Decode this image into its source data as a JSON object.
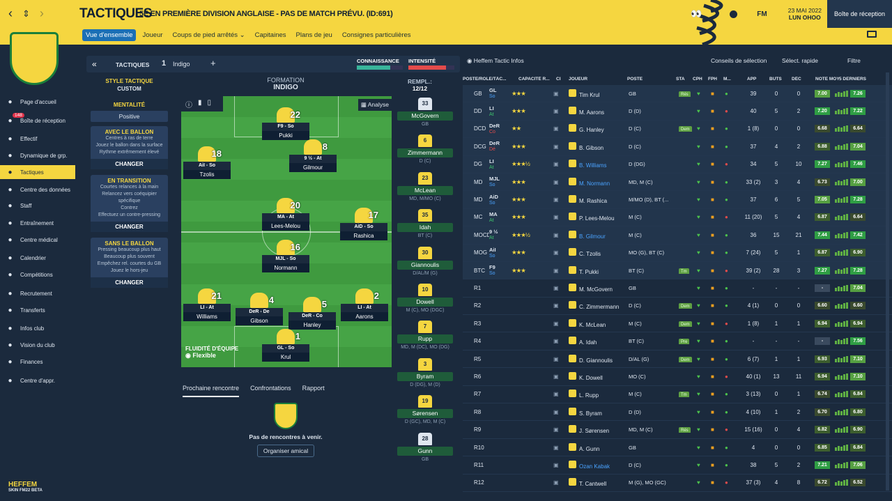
{
  "header": {
    "title": "TACTIQUES",
    "subtitle": "5E EN PREMIÈRE DIVISION ANGLAISE - PAS DE MATCH PRÉVU. (ID:691)",
    "date": "23 MAI 2022",
    "day": "LUN OHOO",
    "inbox": "Boîte de réception",
    "fm": "FM"
  },
  "tabs": [
    "Vue d'ensemble",
    "Joueur",
    "Coups de pied arrêtés ⌄",
    "Capitaines",
    "Plans de jeu",
    "Consignes particulières"
  ],
  "sidebar": {
    "items": [
      {
        "label": "Page d'accueil",
        "icon": "home-icon"
      },
      {
        "label": "Boîte de réception",
        "icon": "mail-icon",
        "badge": "148"
      },
      {
        "label": "Effectif",
        "icon": "shirt-icon"
      },
      {
        "label": "Dynamique de grp.",
        "icon": "chart-icon"
      },
      {
        "label": "Tactiques",
        "icon": "tactics-icon"
      },
      {
        "label": "Centre des données",
        "icon": "data-icon"
      },
      {
        "label": "Staff",
        "icon": "staff-icon"
      },
      {
        "label": "Entraînement",
        "icon": "cone-icon"
      },
      {
        "label": "Centre médical",
        "icon": "medical-icon"
      },
      {
        "label": "Calendrier",
        "icon": "calendar-icon"
      },
      {
        "label": "Compétitions",
        "icon": "trophy-icon"
      },
      {
        "label": "Recrutement",
        "icon": "binoculars-icon"
      },
      {
        "label": "Transferts",
        "icon": "transfer-icon"
      },
      {
        "label": "Infos club",
        "icon": "shield-icon"
      },
      {
        "label": "Vision du club",
        "icon": "eye-icon"
      },
      {
        "label": "Finances",
        "icon": "money-icon"
      },
      {
        "label": "Centre d'appr.",
        "icon": "learn-icon"
      }
    ],
    "brand": "HEFFEM",
    "brand_sub": "SKIN FM22 BETA"
  },
  "tactic_bar": {
    "label": "TACTIQUES",
    "slot": "1",
    "name": "Indigo",
    "knowledge": "CONNAISSANCE",
    "intensity": "INTENSITÉ",
    "knowledge_pct": 0.72,
    "intensity_pct": 0.82
  },
  "style": {
    "title": "STYLE TACTIQUE",
    "value": "CUSTOM",
    "mentality_title": "MENTALITÉ",
    "mentality": "Positive",
    "boxes": [
      {
        "title": "AVEC LE BALLON",
        "lines": [
          "Centres à ras de terre",
          "Jouez le ballon dans la surface",
          "Rythme extrêmement élevé"
        ],
        "btn": "CHANGER"
      },
      {
        "title": "EN TRANSITION",
        "lines": [
          "Courtes relances à la main",
          "Relancez vers coéquipier spécifique",
          "Contrez",
          "Effectuez un contre-pressing"
        ],
        "btn": "CHANGER"
      },
      {
        "title": "SANS LE BALLON",
        "lines": [
          "Pressing beaucoup plus haut",
          "Beaucoup plus souvent",
          "Empêchez rel. courtes du GB",
          "Jouez le hors-jeu"
        ],
        "btn": "CHANGER"
      }
    ]
  },
  "formation": {
    "title": "FORMATION",
    "value": "INDIGO",
    "analyse": "Analyse",
    "fluidity_title": "FLUIDITÉ D'ÉQUIPE",
    "fluidity": "Flexible"
  },
  "pitch_players": [
    {
      "num": "22",
      "role": "F9 - So",
      "name": "Pukki"
    },
    {
      "num": "18",
      "role": "AiI - So",
      "name": "Tzolis"
    },
    {
      "num": "8",
      "role": "9 ½ - At",
      "name": "Gilmour"
    },
    {
      "num": "20",
      "role": "MA - At",
      "name": "Lees-Melou"
    },
    {
      "num": "17",
      "role": "AiD - So",
      "name": "Rashica"
    },
    {
      "num": "16",
      "role": "MJL - So",
      "name": "Normann"
    },
    {
      "num": "21",
      "role": "LI - At",
      "name": "Williams"
    },
    {
      "num": "4",
      "role": "DeR - De",
      "name": "Gibson"
    },
    {
      "num": "5",
      "role": "DeR - Co",
      "name": "Hanley"
    },
    {
      "num": "2",
      "role": "LI - At",
      "name": "Aarons"
    },
    {
      "num": "1",
      "role": "GL - So",
      "name": "Krul"
    }
  ],
  "bottom_tabs": [
    "Prochaine rencontre",
    "Confrontations",
    "Rapport"
  ],
  "next_match": {
    "text": "Pas de rencontres à venir.",
    "btn": "Organiser amical"
  },
  "subs": {
    "title": "REMPL.:",
    "count": "12/12",
    "list": [
      {
        "num": "33",
        "name": "McGovern",
        "pos": "GB"
      },
      {
        "num": "6",
        "name": "Zimmermann",
        "pos": "D (C)"
      },
      {
        "num": "23",
        "name": "McLean",
        "pos": "MD, M/MO (C)"
      },
      {
        "num": "35",
        "name": "Idah",
        "pos": "BT (C)"
      },
      {
        "num": "30",
        "name": "Giannoulis",
        "pos": "D/AL/M (G)"
      },
      {
        "num": "10",
        "name": "Dowell",
        "pos": "M (C), MO (DGC)"
      },
      {
        "num": "7",
        "name": "Rupp",
        "pos": "MD, M (DC), MO (DG)"
      },
      {
        "num": "3",
        "name": "Byram",
        "pos": "D (DG), M (D)"
      },
      {
        "num": "19",
        "name": "Sørensen",
        "pos": "D (GC), MD, M (C)"
      },
      {
        "num": "28",
        "name": "Gunn",
        "pos": "GB"
      }
    ]
  },
  "table_header": {
    "info": "Heffem Tactic Infos",
    "advice": "Conseils de sélection",
    "quick": "Sélect. rapide",
    "filter": "Filtre",
    "cols": [
      "POSTE/RÔLE/TÂC...",
      "CAPACITÉ R...",
      "CI",
      "JOUEUR",
      "POSTE",
      "STA",
      "CPH",
      "FPH",
      "M...",
      "APP",
      "BUTS",
      "DÉC",
      "NOTE MOY",
      "5 DERNIERS M..."
    ]
  },
  "rows": [
    {
      "pos": "GB",
      "role": "GL",
      "duty": "So",
      "stars": "★★★",
      "name": "Tim Krul",
      "poste": "GB",
      "sta": "Rés",
      "app": "39",
      "buts": "0",
      "dec": "0",
      "note": "7.00",
      "last": "7.26"
    },
    {
      "pos": "DD",
      "role": "LI",
      "duty": "At",
      "stars": "★★★",
      "name": "M. Aarons",
      "poste": "D (D)",
      "sta": "",
      "app": "40",
      "buts": "5",
      "dec": "2",
      "note": "7.20",
      "last": "7.22"
    },
    {
      "pos": "DCD",
      "role": "DeR",
      "duty": "Co",
      "stars": "★★",
      "name": "G. Hanley",
      "poste": "D (C)",
      "sta": "Dem",
      "app": "1 (8)",
      "buts": "0",
      "dec": "0",
      "note": "6.68",
      "last": "6.64"
    },
    {
      "pos": "DCG",
      "role": "DeR",
      "duty": "Dé",
      "stars": "★★★",
      "name": "B. Gibson",
      "poste": "D (C)",
      "sta": "",
      "app": "37",
      "buts": "4",
      "dec": "2",
      "note": "6.88",
      "last": "7.04"
    },
    {
      "pos": "DG",
      "role": "LI",
      "duty": "At",
      "stars": "★★★½",
      "name": "B. Williams",
      "poste": "D (DG)",
      "sta": "",
      "app": "34",
      "buts": "5",
      "dec": "10",
      "note": "7.27",
      "last": "7.46"
    },
    {
      "pos": "MD",
      "role": "MJL",
      "duty": "So",
      "stars": "★★★",
      "name": "M. Normann",
      "poste": "MD, M (C)",
      "sta": "",
      "app": "33 (2)",
      "buts": "3",
      "dec": "4",
      "note": "6.73",
      "last": "7.00"
    },
    {
      "pos": "MD",
      "role": "AiD",
      "duty": "So",
      "stars": "★★★",
      "name": "M. Rashica",
      "poste": "M/MO (D), BT (...",
      "sta": "",
      "app": "37",
      "buts": "6",
      "dec": "5",
      "note": "7.05",
      "last": "7.28"
    },
    {
      "pos": "MC",
      "role": "MA",
      "duty": "At",
      "stars": "★★★",
      "name": "P. Lees-Melou",
      "poste": "M (C)",
      "sta": "",
      "app": "11 (20)",
      "buts": "5",
      "dec": "4",
      "note": "6.87",
      "last": "6.64"
    },
    {
      "pos": "MOCD",
      "role": "9 ½",
      "duty": "At",
      "stars": "★★★½",
      "name": "B. Gilmour",
      "poste": "M (C)",
      "sta": "",
      "app": "36",
      "buts": "15",
      "dec": "21",
      "note": "7.44",
      "last": "7.42"
    },
    {
      "pos": "MOG",
      "role": "AiI",
      "duty": "So",
      "stars": "★★★",
      "name": "C. Tzolis",
      "poste": "MO (G), BT (C)",
      "sta": "",
      "app": "7 (24)",
      "buts": "5",
      "dec": "1",
      "note": "6.87",
      "last": "6.90"
    },
    {
      "pos": "BTC",
      "role": "F9",
      "duty": "So",
      "stars": "★★★",
      "name": "T. Pukki",
      "poste": "BT (C)",
      "sta": "Tm",
      "app": "39 (2)",
      "buts": "28",
      "dec": "3",
      "note": "7.27",
      "last": "7.28"
    },
    {
      "pos": "R1",
      "role": "",
      "duty": "",
      "stars": "",
      "name": "M. McGovern",
      "poste": "GB",
      "sta": "",
      "app": "-",
      "buts": "-",
      "dec": "-",
      "note": "-",
      "last": "7.04"
    },
    {
      "pos": "R2",
      "role": "",
      "duty": "",
      "stars": "",
      "name": "C. Zimmermann",
      "poste": "D (C)",
      "sta": "Dem",
      "app": "4 (1)",
      "buts": "0",
      "dec": "0",
      "note": "6.60",
      "last": "6.60"
    },
    {
      "pos": "R3",
      "role": "",
      "duty": "",
      "stars": "",
      "name": "K. McLean",
      "poste": "M (C)",
      "sta": "Dem",
      "app": "1 (8)",
      "buts": "1",
      "dec": "1",
      "note": "6.94",
      "last": "6.94"
    },
    {
      "pos": "R4",
      "role": "",
      "duty": "",
      "stars": "",
      "name": "A. Idah",
      "poste": "BT (C)",
      "sta": "Pre",
      "app": "-",
      "buts": "-",
      "dec": "-",
      "note": "-",
      "last": "7.56"
    },
    {
      "pos": "R5",
      "role": "",
      "duty": "",
      "stars": "",
      "name": "D. Giannoulis",
      "poste": "D/AL (G)",
      "sta": "Dem",
      "app": "6 (7)",
      "buts": "1",
      "dec": "1",
      "note": "6.93",
      "last": "7.10"
    },
    {
      "pos": "R6",
      "role": "",
      "duty": "",
      "stars": "",
      "name": "K. Dowell",
      "poste": "MO (C)",
      "sta": "",
      "app": "40 (1)",
      "buts": "13",
      "dec": "11",
      "note": "6.94",
      "last": "7.10"
    },
    {
      "pos": "R7",
      "role": "",
      "duty": "",
      "stars": "",
      "name": "L. Rupp",
      "poste": "M (C)",
      "sta": "Tm",
      "app": "3 (13)",
      "buts": "0",
      "dec": "1",
      "note": "6.74",
      "last": "6.84"
    },
    {
      "pos": "R8",
      "role": "",
      "duty": "",
      "stars": "",
      "name": "S. Byram",
      "poste": "D (D)",
      "sta": "",
      "app": "4 (10)",
      "buts": "1",
      "dec": "2",
      "note": "6.70",
      "last": "6.80"
    },
    {
      "pos": "R9",
      "role": "",
      "duty": "",
      "stars": "",
      "name": "J. Sørensen",
      "poste": "MD, M (C)",
      "sta": "Rés",
      "app": "15 (16)",
      "buts": "0",
      "dec": "4",
      "note": "6.82",
      "last": "6.90"
    },
    {
      "pos": "R10",
      "role": "",
      "duty": "",
      "stars": "",
      "name": "A. Gunn",
      "poste": "GB",
      "sta": "",
      "app": "4",
      "buts": "0",
      "dec": "0",
      "note": "6.85",
      "last": "6.84"
    },
    {
      "pos": "R11",
      "role": "",
      "duty": "",
      "stars": "",
      "name": "Ozan Kabak",
      "poste": "D (C)",
      "sta": "",
      "app": "38",
      "buts": "5",
      "dec": "2",
      "note": "7.21",
      "last": "7.06"
    },
    {
      "pos": "R12",
      "role": "",
      "duty": "",
      "stars": "",
      "name": "T. Cantwell",
      "poste": "M (G), MO (GC)",
      "sta": "",
      "app": "37 (3)",
      "buts": "4",
      "dec": "8",
      "note": "6.72",
      "last": "6.52"
    }
  ]
}
